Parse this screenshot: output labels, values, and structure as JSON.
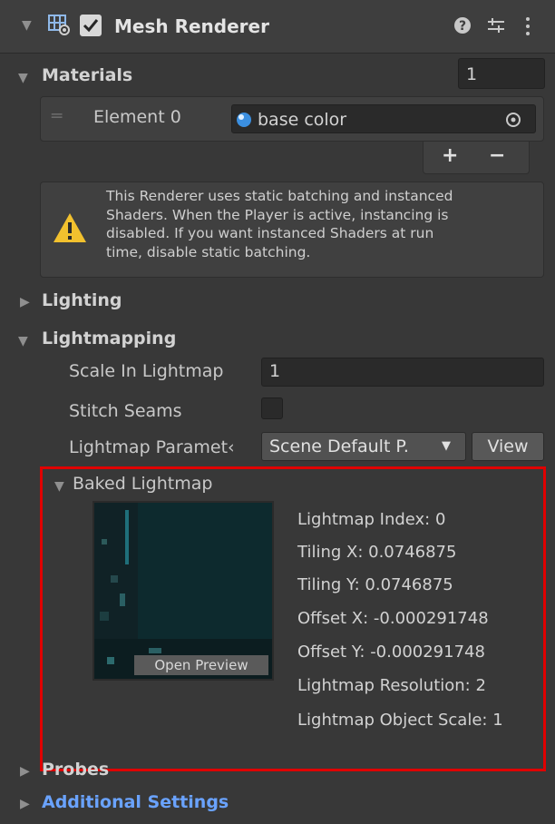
{
  "component": {
    "title": "Mesh Renderer",
    "enabled": true,
    "icons": {
      "help": "help-icon",
      "presets": "presets-sliders-icon",
      "menu": "kebab-menu-icon"
    }
  },
  "materials": {
    "label": "Materials",
    "count": "1",
    "element_label": "Element 0",
    "element_value": "base color",
    "add_label": "+",
    "remove_label": "−"
  },
  "warning": {
    "lines": [
      "This Renderer uses static batching and instanced",
      "Shaders. When the Player is active, instancing is",
      "disabled. If you want instanced Shaders at run",
      "time, disable static batching."
    ]
  },
  "lighting": {
    "label": "Lighting"
  },
  "lightmapping": {
    "label": "Lightmapping",
    "scale_label": "Scale In Lightmap",
    "scale_value": "1",
    "stitch_label": "Stitch Seams",
    "stitch_checked": false,
    "params_label": "Lightmap Paramet‹",
    "params_value": "Scene Default P.",
    "view_label": "View"
  },
  "baked": {
    "label": "Baked Lightmap",
    "preview_label": "Open Preview",
    "lines": [
      "Lightmap Index: 0",
      "Tiling X: 0.0746875",
      "Tiling Y: 0.0746875",
      "Offset X: -0.000291748",
      "Offset Y: -0.000291748",
      "Lightmap Resolution: 2",
      "Lightmap Object Scale: 1"
    ],
    "highlight_color": "#e00000"
  },
  "probes": {
    "label": "Probes"
  },
  "additional": {
    "label": "Additional Settings"
  }
}
